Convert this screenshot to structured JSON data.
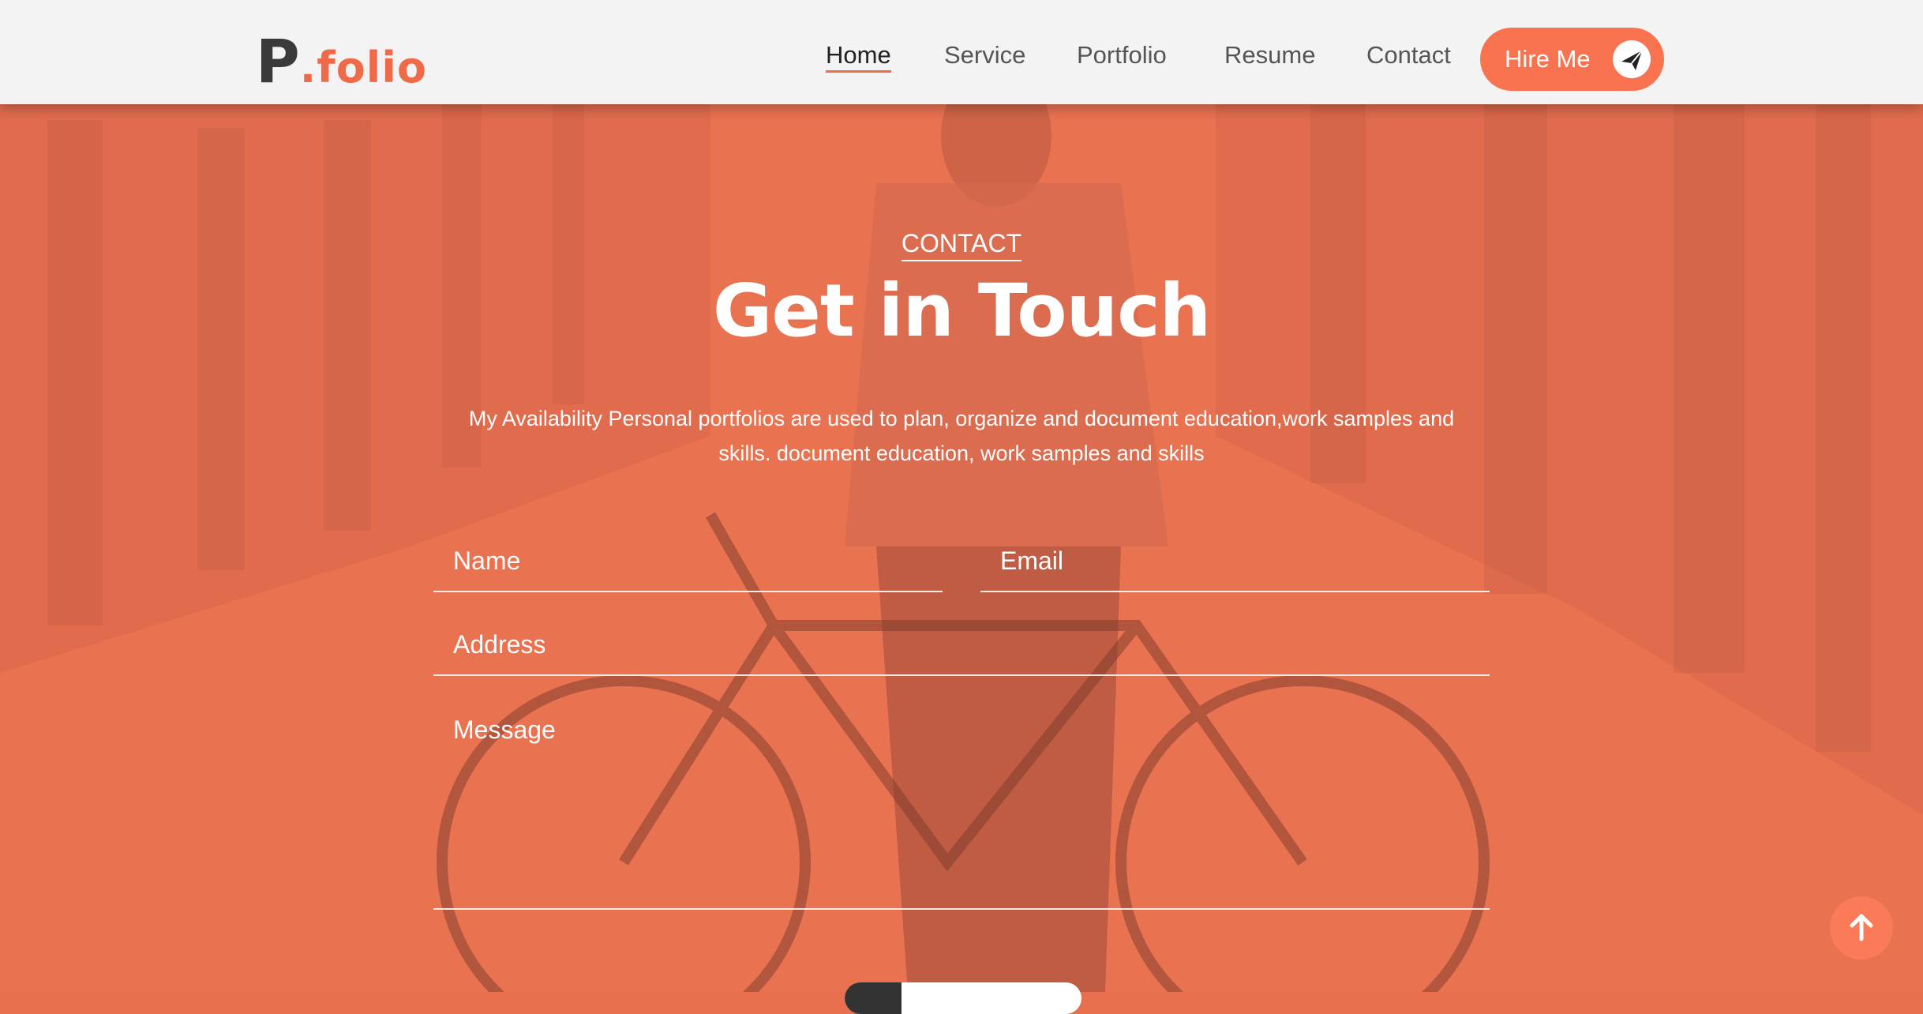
{
  "header": {
    "logo": {
      "letter": "P",
      "rest": ".folio"
    },
    "nav": [
      {
        "label": "Home",
        "active": true
      },
      {
        "label": "Service",
        "active": false
      },
      {
        "label": "Portfolio",
        "active": false
      },
      {
        "label": "Resume",
        "active": false
      },
      {
        "label": "Contact",
        "active": false
      }
    ],
    "hire_button": {
      "label": "Hire Me",
      "icon": "paper-plane-icon"
    }
  },
  "section": {
    "overline": "CONTACT",
    "title": "Get in Touch",
    "description": "My Availability Personal portfolios are used to plan, organize and document education,work samples and skills. document education, work samples and skills"
  },
  "form": {
    "name_placeholder": "Name",
    "email_placeholder": "Email",
    "address_placeholder": "Address",
    "message_placeholder": "Message"
  },
  "scroll_top": {
    "icon": "arrow-up-icon"
  },
  "colors": {
    "accent": "#fa7350",
    "overlay": "#e97251",
    "header_bg": "#f3f3f3"
  }
}
